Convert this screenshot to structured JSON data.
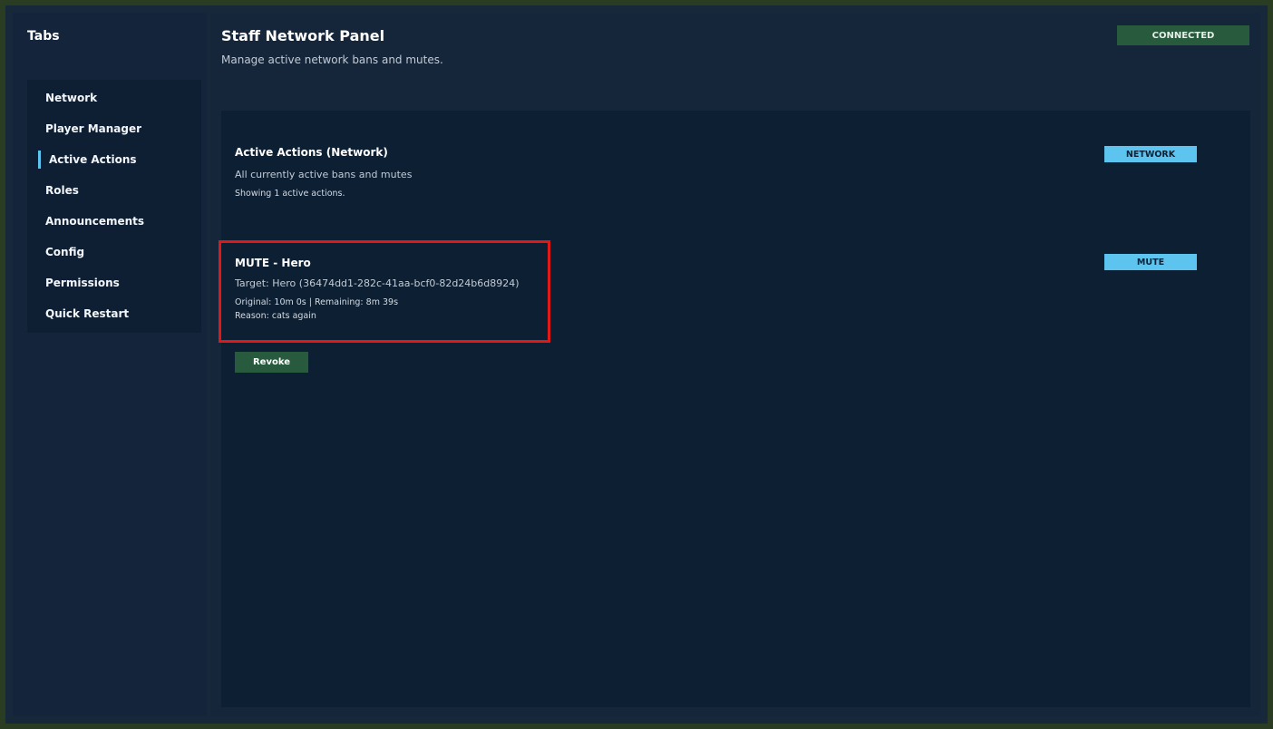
{
  "sidebar": {
    "title": "Tabs",
    "items": [
      {
        "label": "Network"
      },
      {
        "label": "Player Manager"
      },
      {
        "label": "Active Actions"
      },
      {
        "label": "Roles"
      },
      {
        "label": "Announcements"
      },
      {
        "label": "Config"
      },
      {
        "label": "Permissions"
      },
      {
        "label": "Quick Restart"
      }
    ],
    "active_item": "Active Actions"
  },
  "header": {
    "title": "Staff Network Panel",
    "subtitle": "Manage active network bans and mutes.",
    "status": "CONNECTED"
  },
  "section": {
    "title": "Active Actions (Network)",
    "description": "All currently active bans and mutes",
    "count_text": "Showing 1 active actions.",
    "tag": "NETWORK"
  },
  "actions": [
    {
      "title": "MUTE - Hero",
      "target": "Target: Hero (36474dd1-282c-41aa-bcf0-82d24b6d8924)",
      "timing": "Original: 10m 0s | Remaining: 8m 39s",
      "reason": "Reason: cats again",
      "tag": "MUTE",
      "revoke_label": "Revoke"
    }
  ],
  "colors": {
    "accent": "#5cc4ee",
    "success": "#285a3e",
    "highlight_border": "#e01818"
  }
}
